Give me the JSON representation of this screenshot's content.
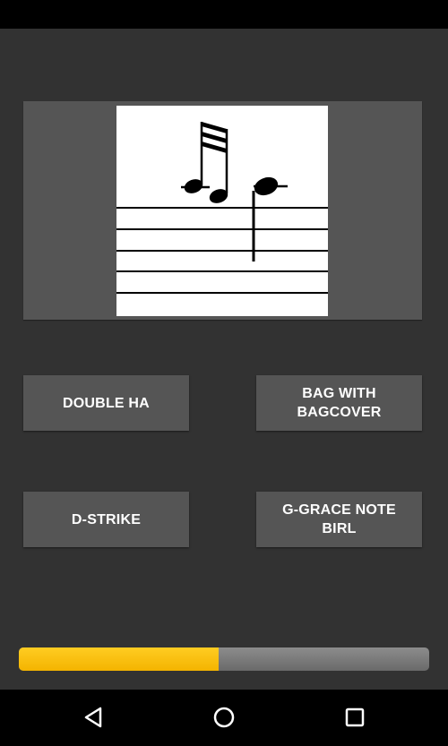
{
  "quiz": {
    "answers": [
      "DOUBLE HA",
      "BAG WITH BAGCOVER",
      "D-STRIKE",
      "G-GRACE NOTE BIRL"
    ],
    "progress_fraction": 0.487
  },
  "colors": {
    "background": "#323232",
    "button": "#555555",
    "progress_fill": "#f4b400",
    "progress_track": "#7a7a7a"
  },
  "icons": {
    "nav_back": "back-triangle-icon",
    "nav_home": "home-circle-icon",
    "nav_recent": "recent-apps-square-icon"
  }
}
